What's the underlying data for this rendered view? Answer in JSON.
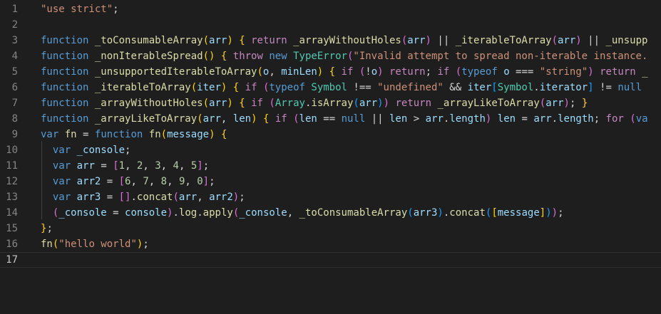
{
  "editor": {
    "lines": [
      {
        "number": "1",
        "tokens": [
          {
            "c": "s",
            "t": "\"use strict\""
          },
          {
            "c": "p",
            "t": ";"
          }
        ]
      },
      {
        "number": "2",
        "tokens": []
      },
      {
        "number": "3",
        "tokens": [
          {
            "c": "k",
            "t": "function"
          },
          {
            "c": "p",
            "t": " "
          },
          {
            "c": "f",
            "t": "_toConsumableArray"
          },
          {
            "c": "b1",
            "t": "("
          },
          {
            "c": "v",
            "t": "arr"
          },
          {
            "c": "b1",
            "t": ")"
          },
          {
            "c": "p",
            "t": " "
          },
          {
            "c": "b1",
            "t": "{"
          },
          {
            "c": "p",
            "t": " "
          },
          {
            "c": "c",
            "t": "return"
          },
          {
            "c": "p",
            "t": " "
          },
          {
            "c": "f",
            "t": "_arrayWithoutHoles"
          },
          {
            "c": "b2",
            "t": "("
          },
          {
            "c": "v",
            "t": "arr"
          },
          {
            "c": "b2",
            "t": ")"
          },
          {
            "c": "p",
            "t": " || "
          },
          {
            "c": "f",
            "t": "_iterableToArray"
          },
          {
            "c": "b2",
            "t": "("
          },
          {
            "c": "v",
            "t": "arr"
          },
          {
            "c": "b2",
            "t": ")"
          },
          {
            "c": "p",
            "t": " || "
          },
          {
            "c": "f",
            "t": "_unsupp"
          }
        ]
      },
      {
        "number": "4",
        "tokens": [
          {
            "c": "k",
            "t": "function"
          },
          {
            "c": "p",
            "t": " "
          },
          {
            "c": "f",
            "t": "_nonIterableSpread"
          },
          {
            "c": "b1",
            "t": "()"
          },
          {
            "c": "p",
            "t": " "
          },
          {
            "c": "b1",
            "t": "{"
          },
          {
            "c": "p",
            "t": " "
          },
          {
            "c": "c",
            "t": "throw"
          },
          {
            "c": "p",
            "t": " "
          },
          {
            "c": "k",
            "t": "new"
          },
          {
            "c": "p",
            "t": " "
          },
          {
            "c": "t",
            "t": "TypeError"
          },
          {
            "c": "b2",
            "t": "("
          },
          {
            "c": "s",
            "t": "\"Invalid attempt to spread non-iterable instance."
          }
        ]
      },
      {
        "number": "5",
        "tokens": [
          {
            "c": "k",
            "t": "function"
          },
          {
            "c": "p",
            "t": " "
          },
          {
            "c": "f",
            "t": "_unsupportedIterableToArray"
          },
          {
            "c": "b1",
            "t": "("
          },
          {
            "c": "v",
            "t": "o"
          },
          {
            "c": "p",
            "t": ", "
          },
          {
            "c": "v",
            "t": "minLen"
          },
          {
            "c": "b1",
            "t": ")"
          },
          {
            "c": "p",
            "t": " "
          },
          {
            "c": "b1",
            "t": "{"
          },
          {
            "c": "p",
            "t": " "
          },
          {
            "c": "c",
            "t": "if"
          },
          {
            "c": "p",
            "t": " "
          },
          {
            "c": "b2",
            "t": "("
          },
          {
            "c": "p",
            "t": "!"
          },
          {
            "c": "v",
            "t": "o"
          },
          {
            "c": "b2",
            "t": ")"
          },
          {
            "c": "p",
            "t": " "
          },
          {
            "c": "c",
            "t": "return"
          },
          {
            "c": "p",
            "t": "; "
          },
          {
            "c": "c",
            "t": "if"
          },
          {
            "c": "p",
            "t": " "
          },
          {
            "c": "b2",
            "t": "("
          },
          {
            "c": "k",
            "t": "typeof"
          },
          {
            "c": "p",
            "t": " "
          },
          {
            "c": "v",
            "t": "o"
          },
          {
            "c": "p",
            "t": " === "
          },
          {
            "c": "s",
            "t": "\"string\""
          },
          {
            "c": "b2",
            "t": ")"
          },
          {
            "c": "p",
            "t": " "
          },
          {
            "c": "c",
            "t": "return"
          },
          {
            "c": "p",
            "t": " "
          },
          {
            "c": "f",
            "t": "_"
          }
        ]
      },
      {
        "number": "6",
        "tokens": [
          {
            "c": "k",
            "t": "function"
          },
          {
            "c": "p",
            "t": " "
          },
          {
            "c": "f",
            "t": "_iterableToArray"
          },
          {
            "c": "b1",
            "t": "("
          },
          {
            "c": "v",
            "t": "iter"
          },
          {
            "c": "b1",
            "t": ")"
          },
          {
            "c": "p",
            "t": " "
          },
          {
            "c": "b1",
            "t": "{"
          },
          {
            "c": "p",
            "t": " "
          },
          {
            "c": "c",
            "t": "if"
          },
          {
            "c": "p",
            "t": " "
          },
          {
            "c": "b2",
            "t": "("
          },
          {
            "c": "k",
            "t": "typeof"
          },
          {
            "c": "p",
            "t": " "
          },
          {
            "c": "t",
            "t": "Symbol"
          },
          {
            "c": "p",
            "t": " !== "
          },
          {
            "c": "s",
            "t": "\"undefined\""
          },
          {
            "c": "p",
            "t": " && "
          },
          {
            "c": "v",
            "t": "iter"
          },
          {
            "c": "b3",
            "t": "["
          },
          {
            "c": "t",
            "t": "Symbol"
          },
          {
            "c": "p",
            "t": "."
          },
          {
            "c": "v",
            "t": "iterator"
          },
          {
            "c": "b3",
            "t": "]"
          },
          {
            "c": "p",
            "t": " != "
          },
          {
            "c": "k",
            "t": "null"
          }
        ]
      },
      {
        "number": "7",
        "tokens": [
          {
            "c": "k",
            "t": "function"
          },
          {
            "c": "p",
            "t": " "
          },
          {
            "c": "f",
            "t": "_arrayWithoutHoles"
          },
          {
            "c": "b1",
            "t": "("
          },
          {
            "c": "v",
            "t": "arr"
          },
          {
            "c": "b1",
            "t": ")"
          },
          {
            "c": "p",
            "t": " "
          },
          {
            "c": "b1",
            "t": "{"
          },
          {
            "c": "p",
            "t": " "
          },
          {
            "c": "c",
            "t": "if"
          },
          {
            "c": "p",
            "t": " "
          },
          {
            "c": "b2",
            "t": "("
          },
          {
            "c": "t",
            "t": "Array"
          },
          {
            "c": "p",
            "t": "."
          },
          {
            "c": "f",
            "t": "isArray"
          },
          {
            "c": "b3",
            "t": "("
          },
          {
            "c": "v",
            "t": "arr"
          },
          {
            "c": "b3",
            "t": ")"
          },
          {
            "c": "b2",
            "t": ")"
          },
          {
            "c": "p",
            "t": " "
          },
          {
            "c": "c",
            "t": "return"
          },
          {
            "c": "p",
            "t": " "
          },
          {
            "c": "f",
            "t": "_arrayLikeToArray"
          },
          {
            "c": "b2",
            "t": "("
          },
          {
            "c": "v",
            "t": "arr"
          },
          {
            "c": "b2",
            "t": ")"
          },
          {
            "c": "p",
            "t": "; "
          },
          {
            "c": "b1",
            "t": "}"
          }
        ]
      },
      {
        "number": "8",
        "tokens": [
          {
            "c": "k",
            "t": "function"
          },
          {
            "c": "p",
            "t": " "
          },
          {
            "c": "f",
            "t": "_arrayLikeToArray"
          },
          {
            "c": "b1",
            "t": "("
          },
          {
            "c": "v",
            "t": "arr"
          },
          {
            "c": "p",
            "t": ", "
          },
          {
            "c": "v",
            "t": "len"
          },
          {
            "c": "b1",
            "t": ")"
          },
          {
            "c": "p",
            "t": " "
          },
          {
            "c": "b1",
            "t": "{"
          },
          {
            "c": "p",
            "t": " "
          },
          {
            "c": "c",
            "t": "if"
          },
          {
            "c": "p",
            "t": " "
          },
          {
            "c": "b2",
            "t": "("
          },
          {
            "c": "v",
            "t": "len"
          },
          {
            "c": "p",
            "t": " == "
          },
          {
            "c": "k",
            "t": "null"
          },
          {
            "c": "p",
            "t": " || "
          },
          {
            "c": "v",
            "t": "len"
          },
          {
            "c": "p",
            "t": " > "
          },
          {
            "c": "v",
            "t": "arr"
          },
          {
            "c": "p",
            "t": "."
          },
          {
            "c": "v",
            "t": "length"
          },
          {
            "c": "b2",
            "t": ")"
          },
          {
            "c": "p",
            "t": " "
          },
          {
            "c": "v",
            "t": "len"
          },
          {
            "c": "p",
            "t": " = "
          },
          {
            "c": "v",
            "t": "arr"
          },
          {
            "c": "p",
            "t": "."
          },
          {
            "c": "v",
            "t": "length"
          },
          {
            "c": "p",
            "t": "; "
          },
          {
            "c": "c",
            "t": "for"
          },
          {
            "c": "p",
            "t": " "
          },
          {
            "c": "b2",
            "t": "("
          },
          {
            "c": "k",
            "t": "va"
          }
        ]
      },
      {
        "number": "9",
        "tokens": [
          {
            "c": "k",
            "t": "var"
          },
          {
            "c": "p",
            "t": " "
          },
          {
            "c": "f",
            "t": "fn"
          },
          {
            "c": "p",
            "t": " = "
          },
          {
            "c": "k",
            "t": "function"
          },
          {
            "c": "p",
            "t": " "
          },
          {
            "c": "f",
            "t": "fn"
          },
          {
            "c": "b1",
            "t": "("
          },
          {
            "c": "v",
            "t": "message"
          },
          {
            "c": "b1",
            "t": ")"
          },
          {
            "c": "p",
            "t": " "
          },
          {
            "c": "b1",
            "t": "{"
          }
        ]
      },
      {
        "number": "10",
        "tokens": [
          {
            "c": "p",
            "t": "  "
          },
          {
            "c": "k",
            "t": "var"
          },
          {
            "c": "p",
            "t": " "
          },
          {
            "c": "v",
            "t": "_console"
          },
          {
            "c": "p",
            "t": ";"
          }
        ]
      },
      {
        "number": "11",
        "tokens": [
          {
            "c": "p",
            "t": "  "
          },
          {
            "c": "k",
            "t": "var"
          },
          {
            "c": "p",
            "t": " "
          },
          {
            "c": "v",
            "t": "arr"
          },
          {
            "c": "p",
            "t": " = "
          },
          {
            "c": "b2",
            "t": "["
          },
          {
            "c": "n",
            "t": "1"
          },
          {
            "c": "p",
            "t": ", "
          },
          {
            "c": "n",
            "t": "2"
          },
          {
            "c": "p",
            "t": ", "
          },
          {
            "c": "n",
            "t": "3"
          },
          {
            "c": "p",
            "t": ", "
          },
          {
            "c": "n",
            "t": "4"
          },
          {
            "c": "p",
            "t": ", "
          },
          {
            "c": "n",
            "t": "5"
          },
          {
            "c": "b2",
            "t": "]"
          },
          {
            "c": "p",
            "t": ";"
          }
        ]
      },
      {
        "number": "12",
        "tokens": [
          {
            "c": "p",
            "t": "  "
          },
          {
            "c": "k",
            "t": "var"
          },
          {
            "c": "p",
            "t": " "
          },
          {
            "c": "v",
            "t": "arr2"
          },
          {
            "c": "p",
            "t": " = "
          },
          {
            "c": "b2",
            "t": "["
          },
          {
            "c": "n",
            "t": "6"
          },
          {
            "c": "p",
            "t": ", "
          },
          {
            "c": "n",
            "t": "7"
          },
          {
            "c": "p",
            "t": ", "
          },
          {
            "c": "n",
            "t": "8"
          },
          {
            "c": "p",
            "t": ", "
          },
          {
            "c": "n",
            "t": "9"
          },
          {
            "c": "p",
            "t": ", "
          },
          {
            "c": "n",
            "t": "0"
          },
          {
            "c": "b2",
            "t": "]"
          },
          {
            "c": "p",
            "t": ";"
          }
        ]
      },
      {
        "number": "13",
        "tokens": [
          {
            "c": "p",
            "t": "  "
          },
          {
            "c": "k",
            "t": "var"
          },
          {
            "c": "p",
            "t": " "
          },
          {
            "c": "v",
            "t": "arr3"
          },
          {
            "c": "p",
            "t": " = "
          },
          {
            "c": "b2",
            "t": "[]"
          },
          {
            "c": "p",
            "t": "."
          },
          {
            "c": "f",
            "t": "concat"
          },
          {
            "c": "b2",
            "t": "("
          },
          {
            "c": "v",
            "t": "arr"
          },
          {
            "c": "p",
            "t": ", "
          },
          {
            "c": "v",
            "t": "arr2"
          },
          {
            "c": "b2",
            "t": ")"
          },
          {
            "c": "p",
            "t": ";"
          }
        ]
      },
      {
        "number": "14",
        "tokens": [
          {
            "c": "p",
            "t": "  "
          },
          {
            "c": "b2",
            "t": "("
          },
          {
            "c": "v",
            "t": "_console"
          },
          {
            "c": "p",
            "t": " = "
          },
          {
            "c": "v",
            "t": "console"
          },
          {
            "c": "b2",
            "t": ")"
          },
          {
            "c": "p",
            "t": "."
          },
          {
            "c": "f",
            "t": "log"
          },
          {
            "c": "p",
            "t": "."
          },
          {
            "c": "f",
            "t": "apply"
          },
          {
            "c": "b2",
            "t": "("
          },
          {
            "c": "v",
            "t": "_console"
          },
          {
            "c": "p",
            "t": ", "
          },
          {
            "c": "f",
            "t": "_toConsumableArray"
          },
          {
            "c": "b3",
            "t": "("
          },
          {
            "c": "v",
            "t": "arr3"
          },
          {
            "c": "b3",
            "t": ")"
          },
          {
            "c": "p",
            "t": "."
          },
          {
            "c": "f",
            "t": "concat"
          },
          {
            "c": "b3",
            "t": "("
          },
          {
            "c": "b1",
            "t": "["
          },
          {
            "c": "v",
            "t": "message"
          },
          {
            "c": "b1",
            "t": "]"
          },
          {
            "c": "b3",
            "t": ")"
          },
          {
            "c": "b2",
            "t": ")"
          },
          {
            "c": "p",
            "t": ";"
          }
        ]
      },
      {
        "number": "15",
        "tokens": [
          {
            "c": "b1",
            "t": "}"
          },
          {
            "c": "p",
            "t": ";"
          }
        ]
      },
      {
        "number": "16",
        "tokens": [
          {
            "c": "f",
            "t": "fn"
          },
          {
            "c": "b1",
            "t": "("
          },
          {
            "c": "s",
            "t": "\"hello world\""
          },
          {
            "c": "b1",
            "t": ")"
          },
          {
            "c": "p",
            "t": ";"
          }
        ]
      },
      {
        "number": "17",
        "tokens": [],
        "current": true
      }
    ]
  }
}
